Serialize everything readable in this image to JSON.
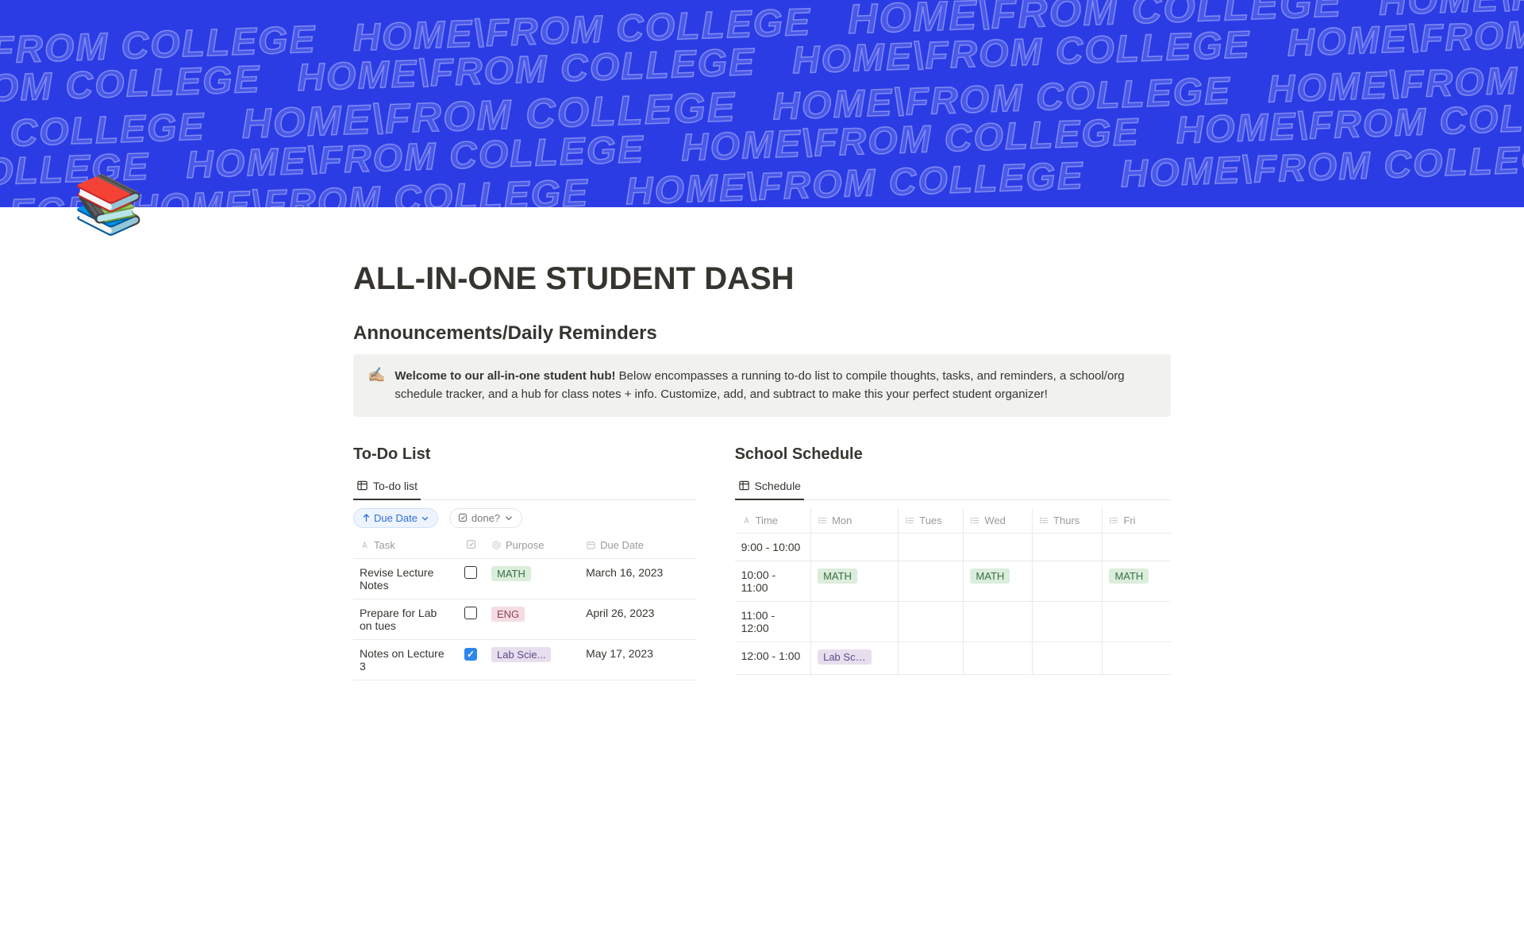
{
  "cover": {
    "text": "HOME\\FROM COLLEGE"
  },
  "icon": "📚",
  "title": "ALL-IN-ONE STUDENT DASH",
  "announcements": {
    "heading": "Announcements/Daily Reminders",
    "callout_icon": "✍🏼",
    "callout_bold": "Welcome to our all-in-one student hub!",
    "callout_rest": " Below encompasses a running to-do list to compile thoughts, tasks, and reminders, a school/org schedule tracker, and a hub for class notes + info. Customize, add, and subtract to make this your perfect student organizer!"
  },
  "todo": {
    "heading": "To-Do List",
    "tab_label": "To-do list",
    "sort_label": "Due Date",
    "filter_label": "done?",
    "cols": {
      "task": "Task",
      "purpose": "Purpose",
      "due": "Due Date"
    },
    "rows": [
      {
        "task": "Revise Lecture Notes",
        "done": false,
        "purpose": "MATH",
        "purpose_class": "math",
        "due": "March 16, 2023"
      },
      {
        "task": "Prepare for Lab on tues",
        "done": false,
        "purpose": "ENG",
        "purpose_class": "eng",
        "due": "April 26, 2023"
      },
      {
        "task": "Notes on Lecture 3",
        "done": true,
        "purpose": "Lab Scie...",
        "purpose_class": "lab",
        "due": "May 17, 2023"
      }
    ]
  },
  "schedule": {
    "heading": "School Schedule",
    "tab_label": "Schedule",
    "cols": {
      "time": "Time",
      "mon": "Mon",
      "tues": "Tues",
      "wed": "Wed",
      "thurs": "Thurs",
      "fri": "Fri"
    },
    "rows": [
      {
        "time": "9:00 - 10:00",
        "mon": "",
        "tues": "",
        "wed": "",
        "thurs": "",
        "fri": ""
      },
      {
        "time": "10:00 - 11:00",
        "mon": "MATH",
        "mon_class": "math",
        "tues": "",
        "wed": "MATH",
        "wed_class": "math",
        "thurs": "",
        "fri": "MATH",
        "fri_class": "math"
      },
      {
        "time": "11:00 - 12:00",
        "mon": "",
        "tues": "",
        "wed": "",
        "thurs": "",
        "fri": ""
      },
      {
        "time": "12:00 - 1:00",
        "mon": "Lab Scie...",
        "mon_class": "lab",
        "tues": "",
        "wed": "",
        "thurs": "",
        "fri": ""
      }
    ]
  }
}
